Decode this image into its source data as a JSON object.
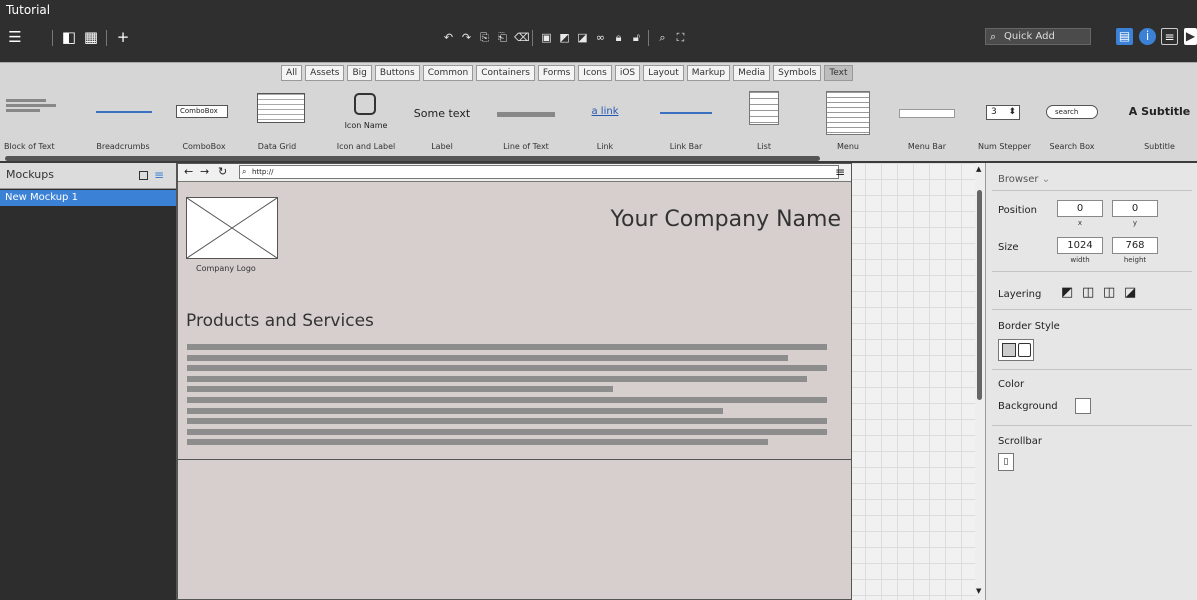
{
  "window": {
    "title": "Tutorial"
  },
  "toolbar": {
    "quick_add_placeholder": "Quick Add"
  },
  "library": {
    "filters": [
      "All",
      "Assets",
      "Big",
      "Buttons",
      "Common",
      "Containers",
      "Forms",
      "Icons",
      "iOS",
      "Layout",
      "Markup",
      "Media",
      "Symbols",
      "Text"
    ],
    "active_filter": "Text",
    "items": [
      {
        "label": "Block of Text"
      },
      {
        "label": "Breadcrumbs"
      },
      {
        "label": "ComboBox",
        "preview": "ComboBox"
      },
      {
        "label": "Data Grid"
      },
      {
        "label": "Icon and Label",
        "preview": "Icon Name"
      },
      {
        "label": "Label",
        "preview": "Some text"
      },
      {
        "label": "Line of Text"
      },
      {
        "label": "Link",
        "preview": "a link"
      },
      {
        "label": "Link Bar"
      },
      {
        "label": "List"
      },
      {
        "label": "Menu"
      },
      {
        "label": "Menu Bar"
      },
      {
        "label": "Num Stepper",
        "preview": "3"
      },
      {
        "label": "Search Box",
        "preview": "search"
      },
      {
        "label": "Subtitle",
        "preview": "A Subtitle"
      }
    ]
  },
  "mockups": {
    "header": "Mockups",
    "items": [
      "New Mockup 1"
    ]
  },
  "canvas": {
    "url": "http://",
    "company_name": "Your Company Name",
    "logo_label": "Company Logo",
    "section_title": "Products and Services",
    "text_lines": [
      0.99,
      0.93,
      0.99,
      0.96,
      0.66,
      0.99,
      0.83,
      0.99,
      0.99,
      0.9
    ]
  },
  "properties": {
    "control": "Browser",
    "position_label": "Position",
    "x": "0",
    "y": "0",
    "x_cap": "x",
    "y_cap": "y",
    "size_label": "Size",
    "width": "1024",
    "height": "768",
    "width_cap": "width",
    "height_cap": "height",
    "layering_label": "Layering",
    "border_style_label": "Border Style",
    "color_label": "Color",
    "background_label": "Background",
    "scrollbar_label": "Scrollbar"
  }
}
